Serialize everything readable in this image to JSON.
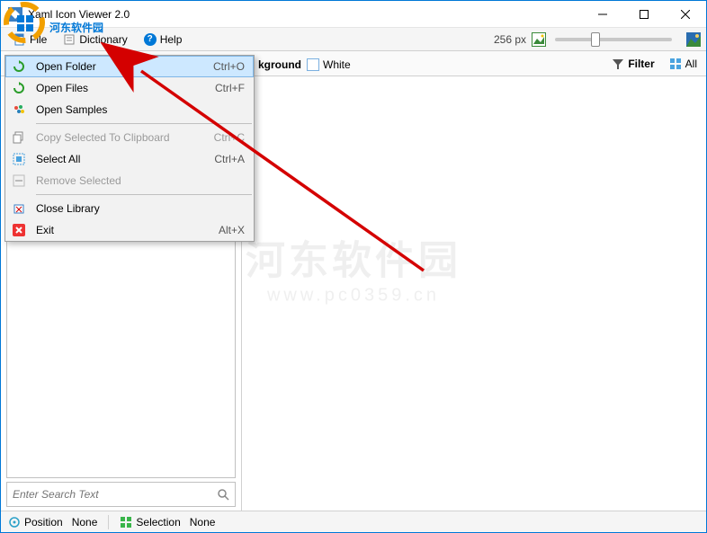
{
  "window": {
    "title": "Xaml Icon Viewer 2.0"
  },
  "menubar": {
    "file": "File",
    "dictionary": "Dictionary",
    "help": "Help",
    "size_label": "256 px"
  },
  "toolbar": {
    "background_label": "kground",
    "white_label": "White",
    "filter_label": "Filter",
    "all_label": "All"
  },
  "context_menu": [
    {
      "icon": "refresh-green-icon",
      "label": "Open Folder",
      "shortcut": "Ctrl+O",
      "highlight": true
    },
    {
      "icon": "refresh-green-icon",
      "label": "Open Files",
      "shortcut": "Ctrl+F"
    },
    {
      "icon": "palette-icon",
      "label": "Open Samples",
      "shortcut": ""
    },
    {
      "sep": true
    },
    {
      "icon": "copy-icon",
      "label": "Copy Selected To Clipboard",
      "shortcut": "Ctrl+C",
      "disabled": true
    },
    {
      "icon": "select-all-icon",
      "label": "Select All",
      "shortcut": "Ctrl+A"
    },
    {
      "icon": "remove-icon",
      "label": "Remove Selected",
      "shortcut": "",
      "disabled": true
    },
    {
      "sep": true
    },
    {
      "icon": "close-library-icon",
      "label": "Close Library",
      "shortcut": ""
    },
    {
      "icon": "exit-red-icon",
      "label": "Exit",
      "shortcut": "Alt+X"
    }
  ],
  "search": {
    "placeholder": "Enter Search Text"
  },
  "status": {
    "position_label": "Position",
    "position_value": "None",
    "selection_label": "Selection",
    "selection_value": "None"
  },
  "watermark": {
    "main": "河东软件园",
    "sub": "www.pc0359.cn"
  },
  "colors": {
    "accent": "#0078d7",
    "highlight_bg": "#cde8ff",
    "highlight_border": "#7eb6e6",
    "arrow": "#d40000"
  }
}
